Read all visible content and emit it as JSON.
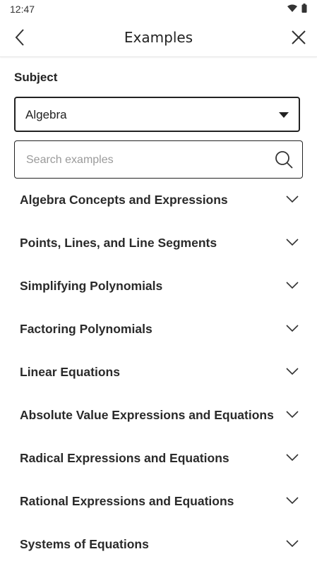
{
  "status_bar": {
    "time": "12:47"
  },
  "header": {
    "title": "Examples"
  },
  "subject": {
    "label": "Subject",
    "selected": "Algebra"
  },
  "search": {
    "placeholder": "Search examples",
    "value": ""
  },
  "topics": [
    {
      "label": "Algebra Concepts and Expressions"
    },
    {
      "label": "Points, Lines, and Line Segments"
    },
    {
      "label": "Simplifying Polynomials"
    },
    {
      "label": "Factoring Polynomials"
    },
    {
      "label": "Linear Equations"
    },
    {
      "label": "Absolute Value Expressions and Equations"
    },
    {
      "label": "Radical Expressions and Equations"
    },
    {
      "label": "Rational Expressions and Equations"
    },
    {
      "label": "Systems of Equations"
    }
  ]
}
